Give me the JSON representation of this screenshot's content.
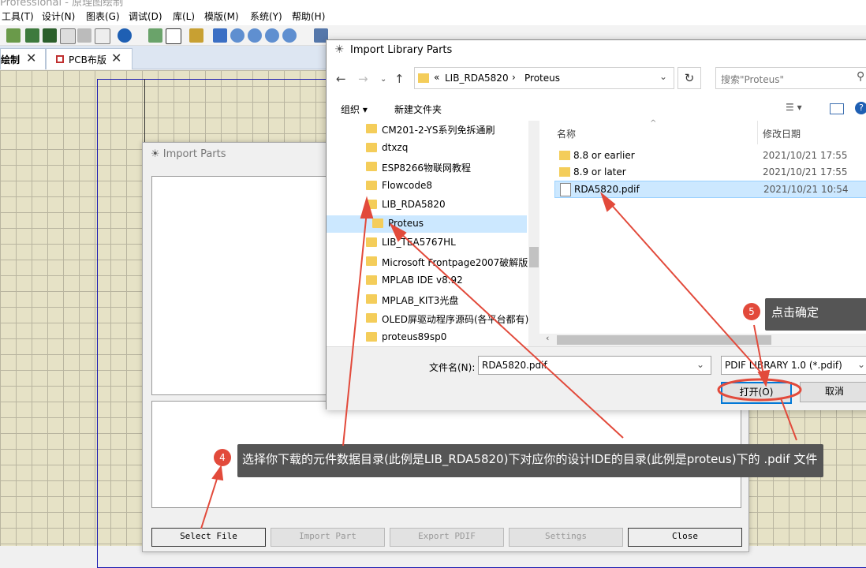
{
  "app": {
    "title": "Professional - 原理图绘制",
    "menu": [
      "工具(T)",
      "设计(N)",
      "图表(G)",
      "调试(D)",
      "库(L)",
      "模版(M)",
      "系统(Y)",
      "帮助(H)"
    ],
    "tabs": [
      {
        "label": "绘制"
      },
      {
        "label": "PCB布版"
      }
    ]
  },
  "import_parts": {
    "title": "Import Parts",
    "buttons": [
      "Select File",
      "Import Part",
      "Export PDIF",
      "Settings",
      "Close"
    ]
  },
  "file_dialog": {
    "title": "Import Library Parts",
    "breadcrumb": {
      "prefix": "«",
      "part1": "LIB_RDA5820",
      "sep": "›",
      "part2": "Proteus"
    },
    "search_placeholder": "搜索\"Proteus\"",
    "organize_label": "组织 ▾",
    "new_folder_label": "新建文件夹",
    "tree": [
      "CM201-2-YS系列免拆通刷",
      "dtxzq",
      "ESP8266物联网教程",
      "Flowcode8",
      "LIB_RDA5820",
      "Proteus",
      "LIB_TEA5767HL",
      "Microsoft Frontpage2007破解版",
      "MPLAB IDE v8.92",
      "MPLAB_KIT3光盘",
      "OLED屏驱动程序源码(各平台都有)",
      "proteus89sp0"
    ],
    "columns": {
      "name": "名称",
      "date": "修改日期"
    },
    "files": [
      {
        "name": "8.8 or earlier",
        "date": "2021/10/21 17:55"
      },
      {
        "name": "8.9 or later",
        "date": "2021/10/21 17:55"
      },
      {
        "name": "RDA5820.pdif",
        "date": "2021/10/21 10:54"
      }
    ],
    "filename_label": "文件名(N):",
    "filename_value": "RDA5820.pdif",
    "filetype_value": "PDIF LIBRARY 1.0 (*.pdif)",
    "open_label": "打开(O)",
    "cancel_label": "取消"
  },
  "callouts": {
    "step4_num": "4",
    "step4_text": "选择你下载的元件数据目录(此例是LIB_RDA5820)下对应你的设计IDE的目录(此例是proteus)下的 .pdif 文件",
    "step5_num": "5",
    "step5_text": "点击确定"
  },
  "colors": {
    "annotation": "#e24a3b",
    "selection": "#cce8ff",
    "sheet_border": "#1a1ab0"
  }
}
